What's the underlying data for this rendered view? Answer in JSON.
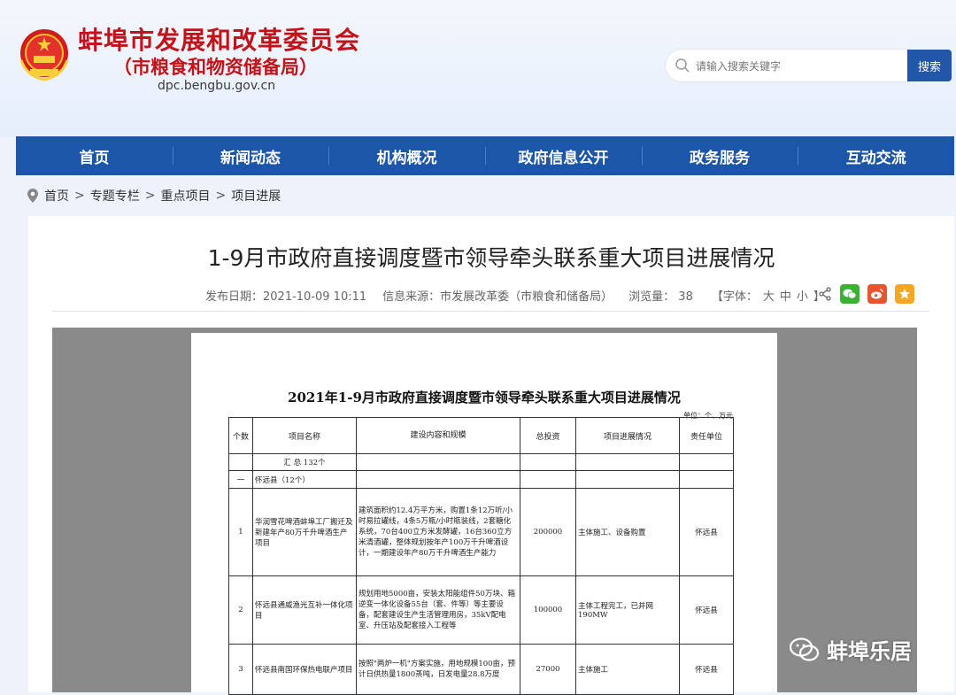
{
  "header": {
    "title": "蚌埠市发展和改革委员会",
    "subtitle": "（市粮食和物资储备局）",
    "domain": "dpc.bengbu.gov.cn",
    "search_placeholder": "请输入搜索关键字",
    "search_button": "搜索"
  },
  "nav": [
    "首页",
    "新闻动态",
    "机构概况",
    "政府信息公开",
    "政务服务",
    "互动交流"
  ],
  "breadcrumb": [
    "首页",
    "专题专栏",
    "重点项目",
    "项目进展"
  ],
  "article": {
    "title": "1-9月市政府直接调度暨市领导牵头联系重大项目进展情况",
    "publish_date": "发布日期：2021-10-09 10:11",
    "source": "信息来源：市发展改革委（市粮食和储备局）",
    "views": "浏览量： 38",
    "font_size_label": "【字体：",
    "font_sizes": [
      "大",
      "中",
      "小"
    ],
    "font_size_end": "】"
  },
  "doc": {
    "title": "2021年1-9月市政府直接调度暨市领导牵头联系重大项目进展情况",
    "unit": "单位：个、万元",
    "headers": [
      "个数",
      "项目名称",
      "建设内容和规模",
      "总投资",
      "项目进展情况",
      "责任单位"
    ],
    "summary": "汇 总 132个",
    "county_num": "一",
    "county": "怀远县（12个）",
    "rows": [
      {
        "num": "1",
        "name": "华润雪花啤酒蚌埠工厂搬迁及新建年产80万千升啤酒生产项目",
        "scope": "建筑面积约12.4万平方米，购置1条12万听/小时易拉罐线，4条5万瓶/小时瓶装线，2套糖化系统，70台400立方米发酵罐，16台360立方米清酒罐，整体规划按年产100万千升啤酒设计，一期建设年产80万千升啤酒生产能力",
        "investment": "200000",
        "progress": "主体施工、设备购置",
        "unit": "怀远县"
      },
      {
        "num": "2",
        "name": "怀远县通威渔光互补一体化项目",
        "scope": "规划用地5000亩，安装太阳能组件50万块、箱逆变一体化设备55台（套、件等）等主要设备，配套建设生产生活管理用房，35kV配电室、升压站及配套接入工程等",
        "investment": "100000",
        "progress": "主体工程完工，已并网190MW",
        "unit": "怀远县"
      },
      {
        "num": "3",
        "name": "怀远县南国环保热电联产项目",
        "scope": "按照\"两炉一机\"方案实施，用地规模100亩，预计日供热量1800蒸吨，日发电量28.8万度",
        "investment": "27000",
        "progress": "主体施工",
        "unit": "怀远县"
      }
    ]
  },
  "watermark": "蚌埠乐居",
  "colors": {
    "brand_red": "#c2131a",
    "nav_blue": "#1b56a8",
    "search_blue": "#2256a8"
  }
}
